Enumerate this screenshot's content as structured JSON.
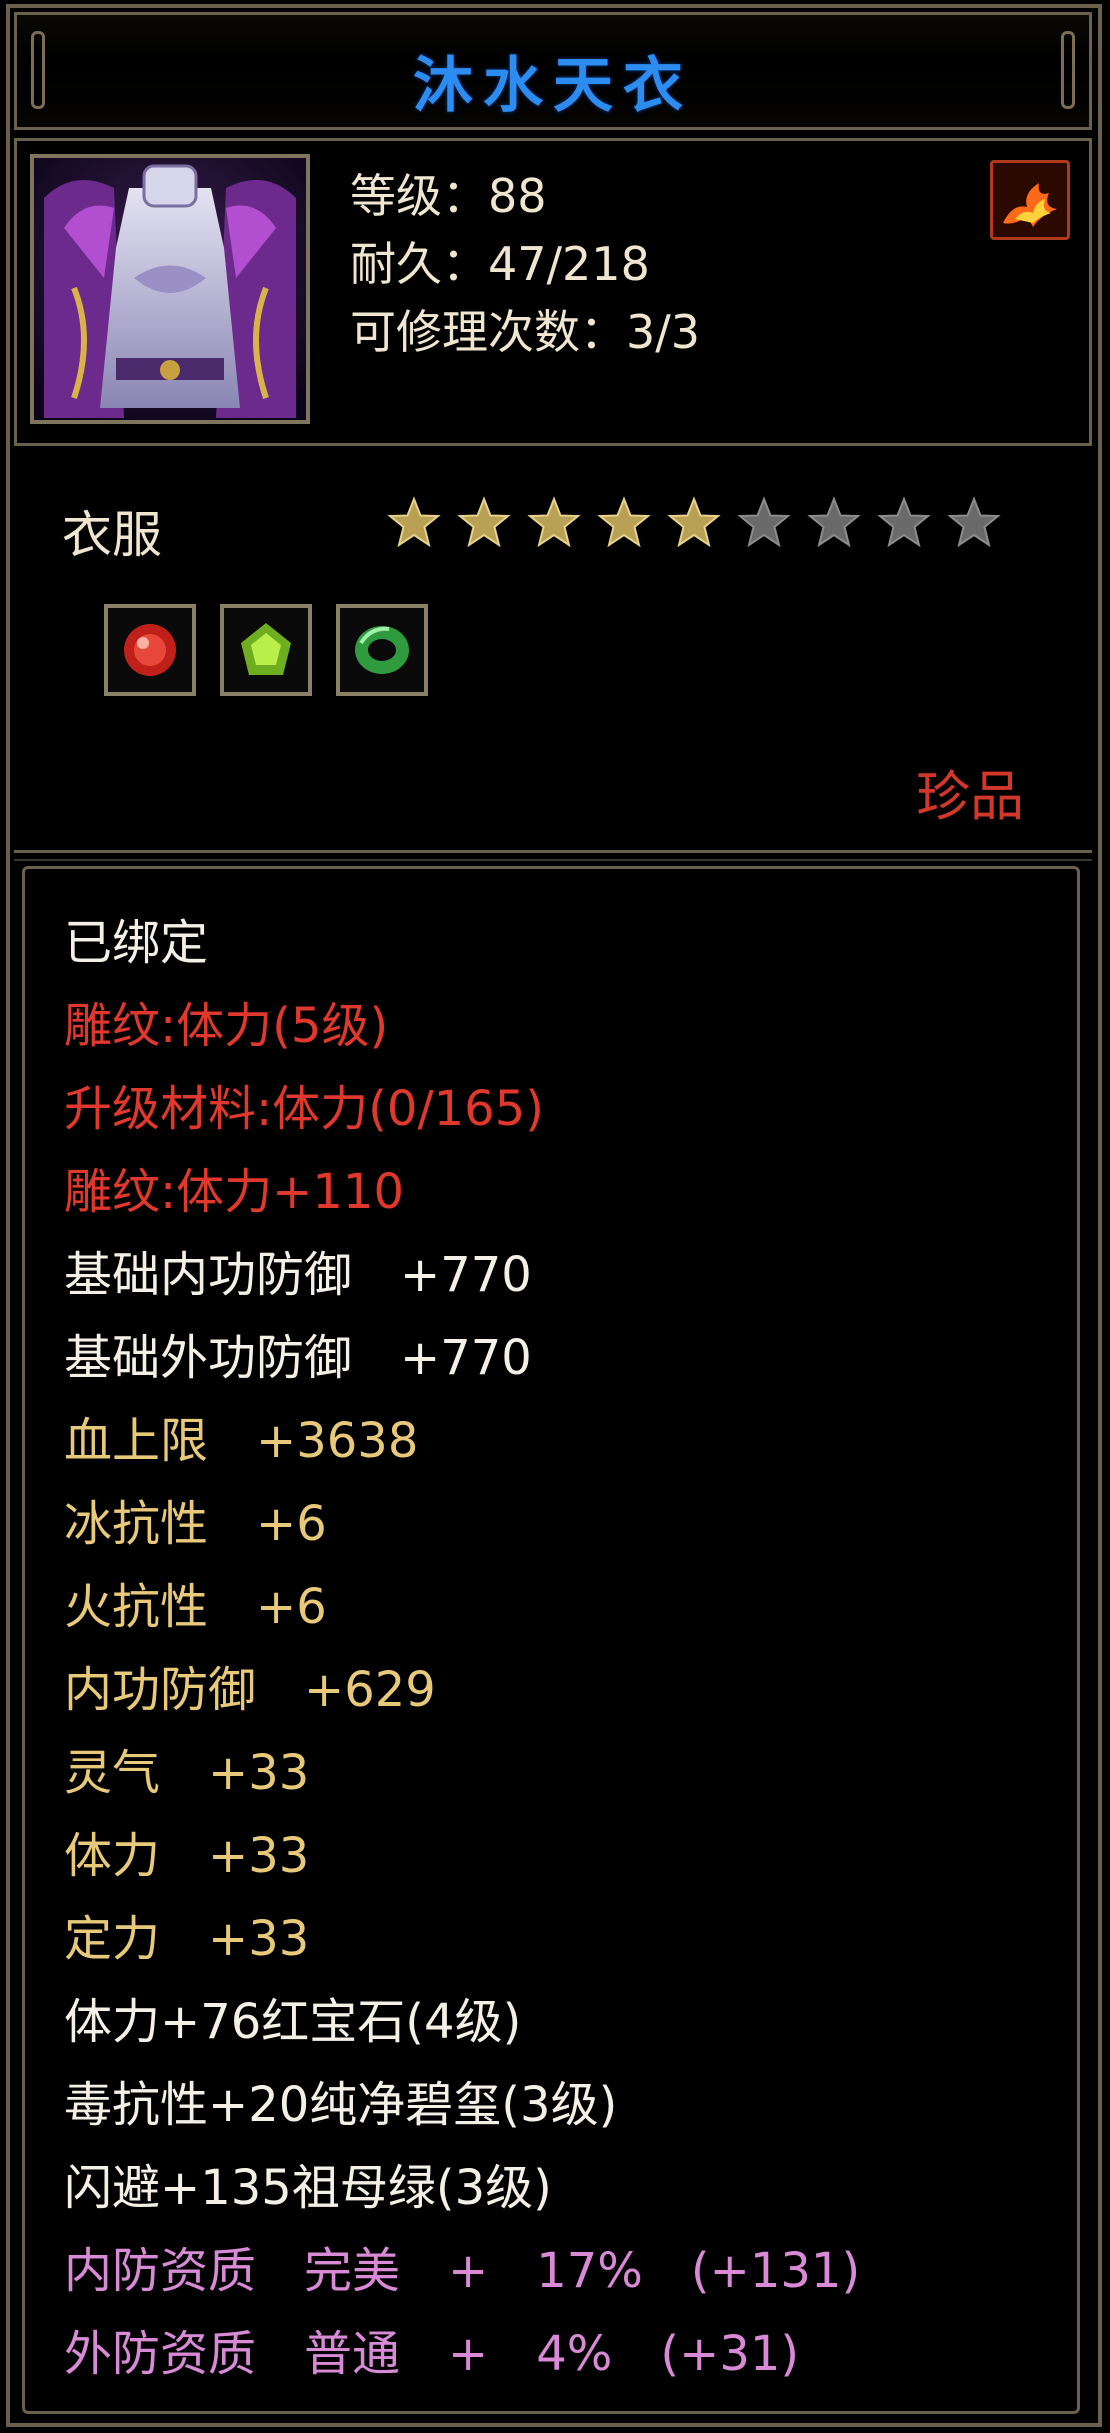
{
  "item": {
    "name": "沐水天衣",
    "level_line": "等级：88",
    "durability_line": "耐久：47/218",
    "repair_line": "可修理次数：3/3",
    "category": "衣服",
    "quality": "珍品",
    "stars": {
      "filled": 5,
      "total": 9,
      "filled_color": "#b8a055",
      "empty_color": "#6a6a6a"
    },
    "gems": [
      {
        "name": "red-gem-icon",
        "color": "#c0201a"
      },
      {
        "name": "green-gem-icon",
        "color": "#8ccf2a"
      },
      {
        "name": "jade-ring-icon",
        "color": "#2f9a3e"
      }
    ]
  },
  "attributes": [
    {
      "text": "已绑定",
      "style": "white"
    },
    {
      "text": "雕纹:体力(5级)",
      "style": "red"
    },
    {
      "text": "升级材料:体力(0/165)",
      "style": "red"
    },
    {
      "text": "雕纹:体力+110",
      "style": "red"
    },
    {
      "text": "基础内功防御　+770",
      "style": "white"
    },
    {
      "text": "基础外功防御　+770",
      "style": "white"
    },
    {
      "text": "血上限　+3638",
      "style": "gold"
    },
    {
      "text": "冰抗性　+6",
      "style": "gold"
    },
    {
      "text": "火抗性　+6",
      "style": "gold"
    },
    {
      "text": "内功防御　+629",
      "style": "gold"
    },
    {
      "text": "灵气　+33",
      "style": "gold"
    },
    {
      "text": "体力　+33",
      "style": "gold"
    },
    {
      "text": "定力　+33",
      "style": "gold"
    },
    {
      "text": "体力+76红宝石(4级)",
      "style": "white"
    },
    {
      "text": "毒抗性+20纯净碧玺(3级)",
      "style": "white"
    },
    {
      "text": "闪避+135祖母绿(3级)",
      "style": "white"
    },
    {
      "text": "内防资质　完美　+　17%　(+131)",
      "style": "pink"
    },
    {
      "text": "外防资质　普通　+　4%　(+31)",
      "style": "pink"
    }
  ]
}
